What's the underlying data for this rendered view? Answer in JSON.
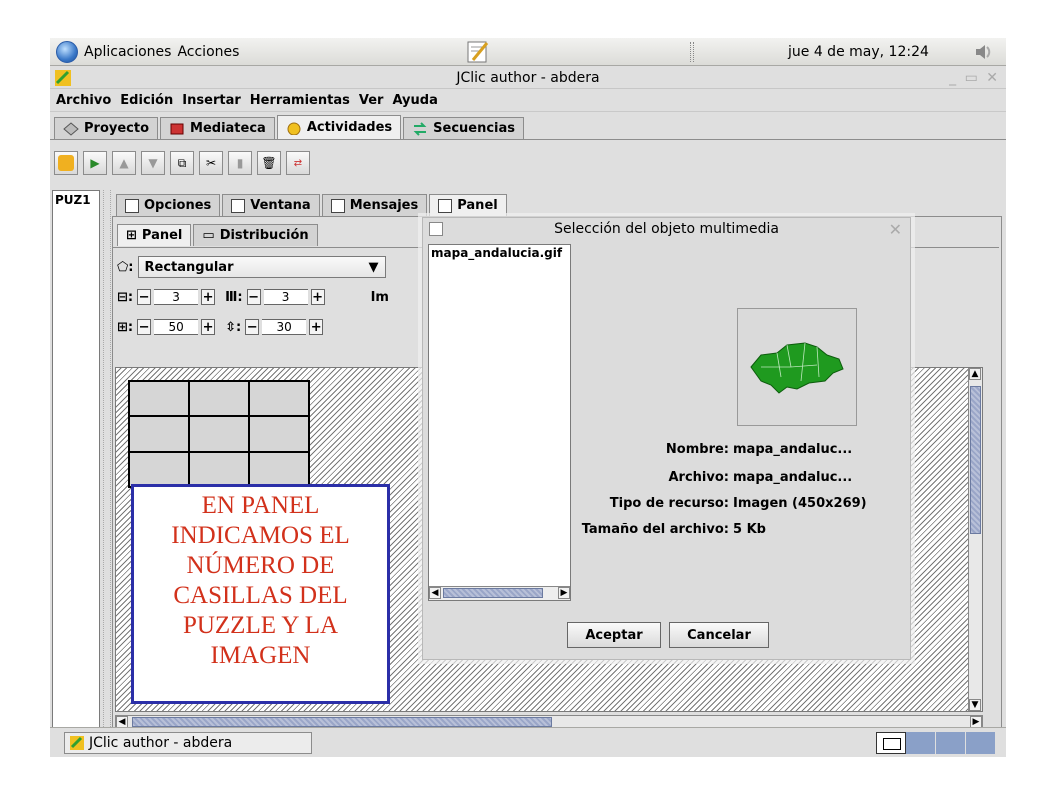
{
  "top_panel": {
    "applications": "Aplicaciones",
    "actions": "Acciones",
    "clock": "jue  4 de may, 12:24"
  },
  "window": {
    "title": "JClic author - abdera"
  },
  "menubar": [
    "Archivo",
    "Edición",
    "Insertar",
    "Herramientas",
    "Ver",
    "Ayuda"
  ],
  "main_tabs": [
    "Proyecto",
    "Mediateca",
    "Actividades",
    "Secuencias"
  ],
  "active_main_tab": "Actividades",
  "activity_list": [
    "PUZ1"
  ],
  "sub_tabs": [
    "Opciones",
    "Ventana",
    "Mensajes",
    "Panel"
  ],
  "inner_tabs": [
    "Panel",
    "Distribución"
  ],
  "panel_settings": {
    "shape_value": "Rectangular",
    "rows": "3",
    "cols": "3",
    "width": "50",
    "height": "30",
    "image_label_partial": "Im"
  },
  "grid": {
    "rows": 3,
    "cols": 3
  },
  "dialog": {
    "title": "Selección del objeto multimedia",
    "files": [
      "mapa_andalucia.gif"
    ],
    "info": [
      {
        "key": "Nombre:",
        "value": "mapa_andaluc..."
      },
      {
        "key": "Archivo:",
        "value": "mapa_andaluc..."
      },
      {
        "key": "Tipo de recurso:",
        "value": "Imagen (450x269)"
      },
      {
        "key": "Tamaño del archivo:",
        "value": "5 Kb"
      }
    ],
    "accept": "Aceptar",
    "cancel": "Cancelar"
  },
  "annotation": {
    "lines": [
      "EN PANEL",
      "INDICAMOS EL",
      "NÚMERO DE",
      "CASILLAS DEL",
      "PUZZLE Y LA",
      "IMAGEN"
    ],
    "text_color": "#d2311b",
    "border_color": "#2b2fa8"
  },
  "taskbar": {
    "task": "JClic author - abdera"
  }
}
